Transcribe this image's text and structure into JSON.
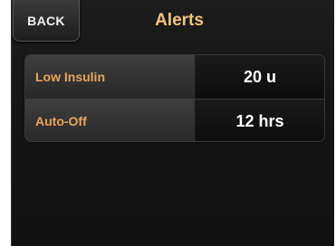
{
  "header": {
    "back_label": "BACK",
    "title": "Alerts"
  },
  "settings": [
    {
      "label": "Low Insulin",
      "value": "20 u"
    },
    {
      "label": "Auto-Off",
      "value": "12 hrs"
    }
  ],
  "colors": {
    "title": "#f1c37a",
    "label": "#e9a65b",
    "value": "#ffffff",
    "background": "#151515"
  }
}
